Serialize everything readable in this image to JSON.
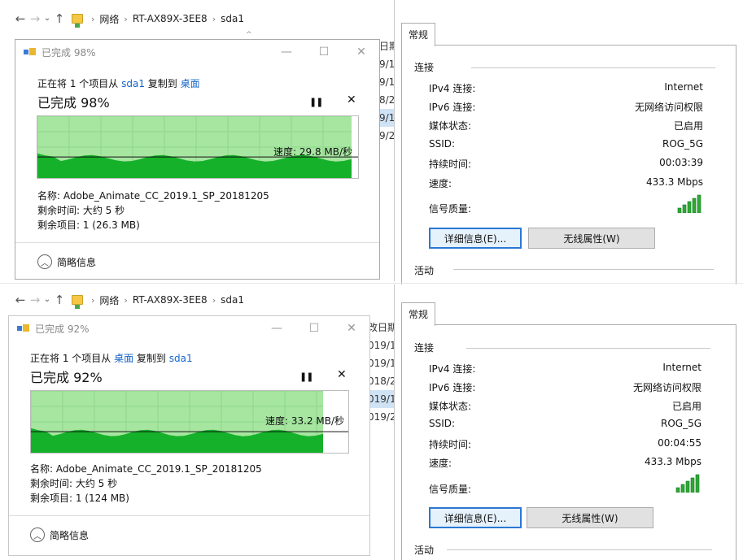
{
  "top": {
    "address": {
      "root": "网络",
      "device": "RT-AX89X-3EE8",
      "folder": "sda1"
    },
    "bg_header": "日期",
    "bg_dates": [
      "9/1",
      "9/1",
      "8/2",
      "9/1",
      "9/2"
    ],
    "copy_dialog": {
      "title": "已完成 98%",
      "line_prefix": "正在将 1 个项目从 ",
      "from": "sda1",
      "middle": " 复制到 ",
      "to": "桌面",
      "percent_text": "已完成 98%",
      "progress": 0.98,
      "speed": "速度: 29.8 MB/秒",
      "name": "名称: Adobe_Animate_CC_2019.1_SP_20181205",
      "time_left": "剩余时间: 大约 5 秒",
      "items_left": "剩余项目: 1 (26.3 MB)",
      "less_info": "简略信息"
    },
    "wifi": {
      "tab": "常规",
      "group_connection": "连接",
      "rows": [
        {
          "label": "IPv4 连接:",
          "value": "Internet"
        },
        {
          "label": "IPv6 连接:",
          "value": "无网络访问权限"
        },
        {
          "label": "媒体状态:",
          "value": "已启用"
        },
        {
          "label": "SSID:",
          "value": "ROG_5G"
        },
        {
          "label": "持续时间:",
          "value": "00:03:39"
        },
        {
          "label": "速度:",
          "value": "433.3 Mbps"
        }
      ],
      "signal_label": "信号质量:",
      "signal_bars": 5,
      "details_button": "详细信息(E)...",
      "wireless_button": "无线属性(W)",
      "group_activity": "活动"
    }
  },
  "bottom": {
    "address": {
      "root": "网络",
      "device": "RT-AX89X-3EE8",
      "folder": "sda1"
    },
    "bg_header": "改日期",
    "bg_dates": [
      "019/1",
      "019/1",
      "018/2",
      "019/1",
      "019/2"
    ],
    "copy_dialog": {
      "title": "已完成 92%",
      "line_prefix": "正在将 1 个项目从 ",
      "from": "桌面",
      "middle": " 复制到 ",
      "to": "sda1",
      "percent_text": "已完成 92%",
      "progress": 0.92,
      "speed": "速度: 33.2 MB/秒",
      "name": "名称: Adobe_Animate_CC_2019.1_SP_20181205",
      "time_left": "剩余时间: 大约 5 秒",
      "items_left": "剩余项目: 1 (124 MB)",
      "less_info": "简略信息"
    },
    "wifi": {
      "tab": "常规",
      "group_connection": "连接",
      "rows": [
        {
          "label": "IPv4 连接:",
          "value": "Internet"
        },
        {
          "label": "IPv6 连接:",
          "value": "无网络访问权限"
        },
        {
          "label": "媒体状态:",
          "value": "已启用"
        },
        {
          "label": "SSID:",
          "value": "ROG_5G"
        },
        {
          "label": "持续时间:",
          "value": "00:04:55"
        },
        {
          "label": "速度:",
          "value": "433.3 Mbps"
        }
      ],
      "signal_label": "信号质量:",
      "signal_bars": 5,
      "details_button": "详细信息(E)...",
      "wireless_button": "无线属性(W)",
      "group_activity": "活动"
    }
  },
  "colors": {
    "graph_fill_light": "#a6e6a0",
    "graph_fill_dark": "#16b12a",
    "link": "#1464c8",
    "focus_border": "#2a78d2"
  }
}
